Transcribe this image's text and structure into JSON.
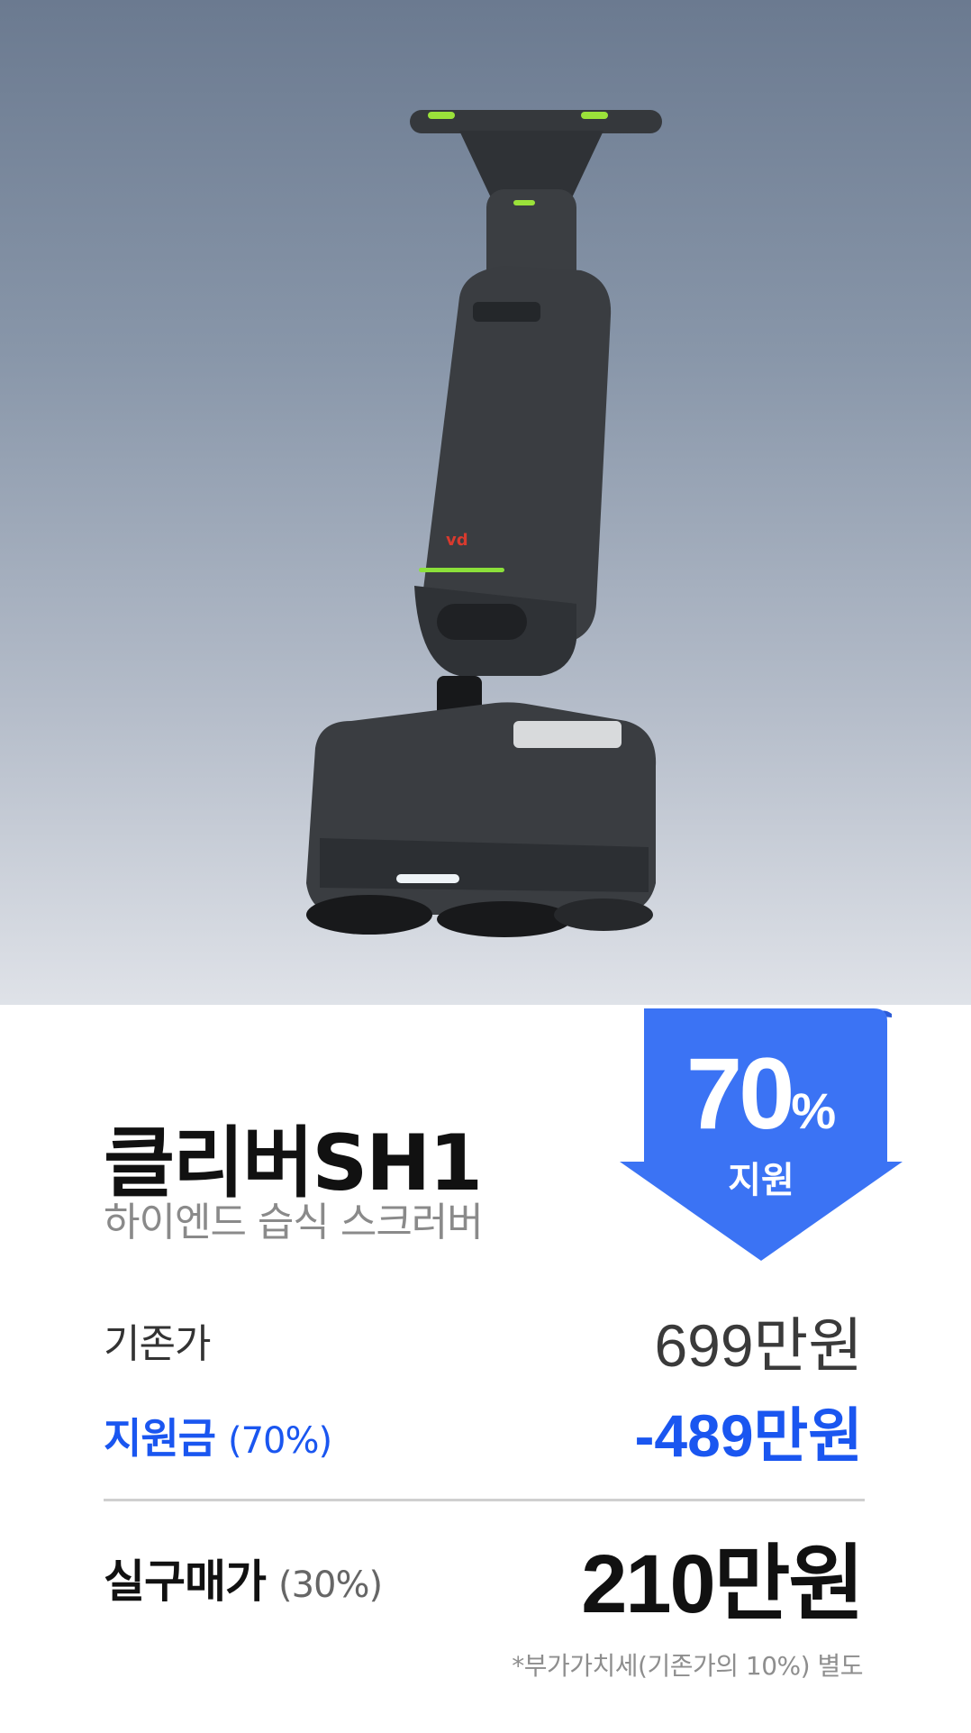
{
  "product": {
    "name": "클리버SH1",
    "subtitle": "하이엔드 습식 스크러버"
  },
  "badge": {
    "percent_value": "70",
    "percent_sign": "%",
    "label": "지원",
    "color": "#3b73f4"
  },
  "pricing": {
    "original_label": "기존가",
    "original_value": "699만원",
    "subsidy_label": "지원금",
    "subsidy_pct": "(70%)",
    "subsidy_value": "-489만원",
    "final_label": "실구매가",
    "final_pct": "(30%)",
    "final_value": "210만원",
    "note": "*부가가치세(기존가의 10%) 별도"
  },
  "colors": {
    "accent_blue": "#1a56f0",
    "hero_top": "#6b7a90",
    "hero_bottom": "#dfe2e8"
  }
}
